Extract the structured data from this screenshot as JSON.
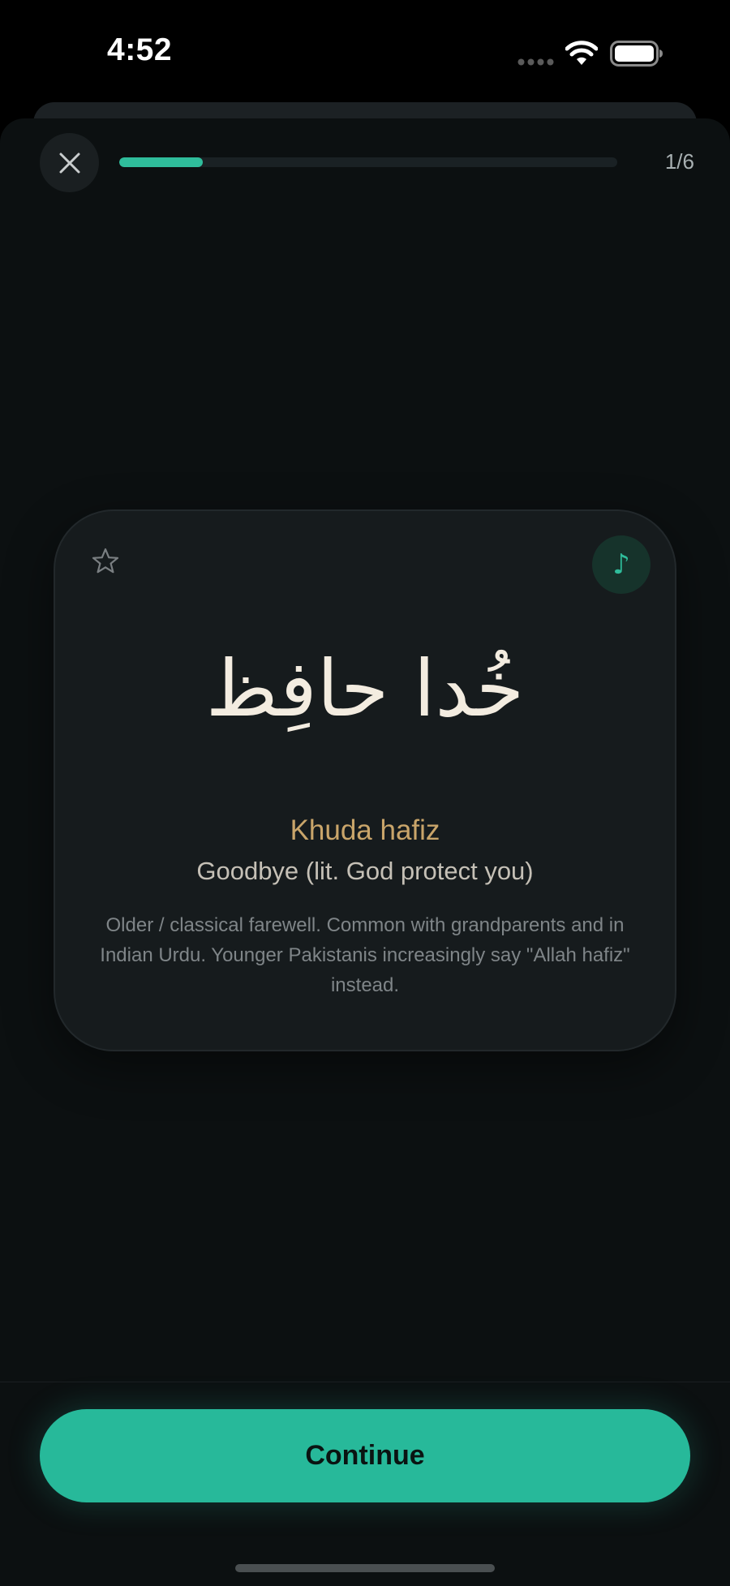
{
  "status_bar": {
    "time": "4:52",
    "icons": [
      "signal-dots-icon",
      "wifi-icon",
      "battery-icon"
    ]
  },
  "header": {
    "close_icon": "close-icon",
    "progress": {
      "current": 1,
      "total": 6,
      "fraction": 0.167
    },
    "progress_label": "1/6"
  },
  "card": {
    "favorite_icon": "star-outline-icon",
    "audio_icon": "music-note-icon",
    "audio_glyph": "♪",
    "urdu": "خُدا حافِظ",
    "transliteration": "Khuda hafiz",
    "translation": "Goodbye (lit. God protect you)",
    "note": "Older / classical farewell. Common with grandparents and in Indian Urdu. Younger Pakistanis increasingly say \"Allah hafiz\" instead."
  },
  "footer": {
    "continue_label": "Continue"
  },
  "colors": {
    "accent": "#2fbd9b",
    "gold": "#c9a56a",
    "background": "#0c1011",
    "card": "#161b1d"
  }
}
